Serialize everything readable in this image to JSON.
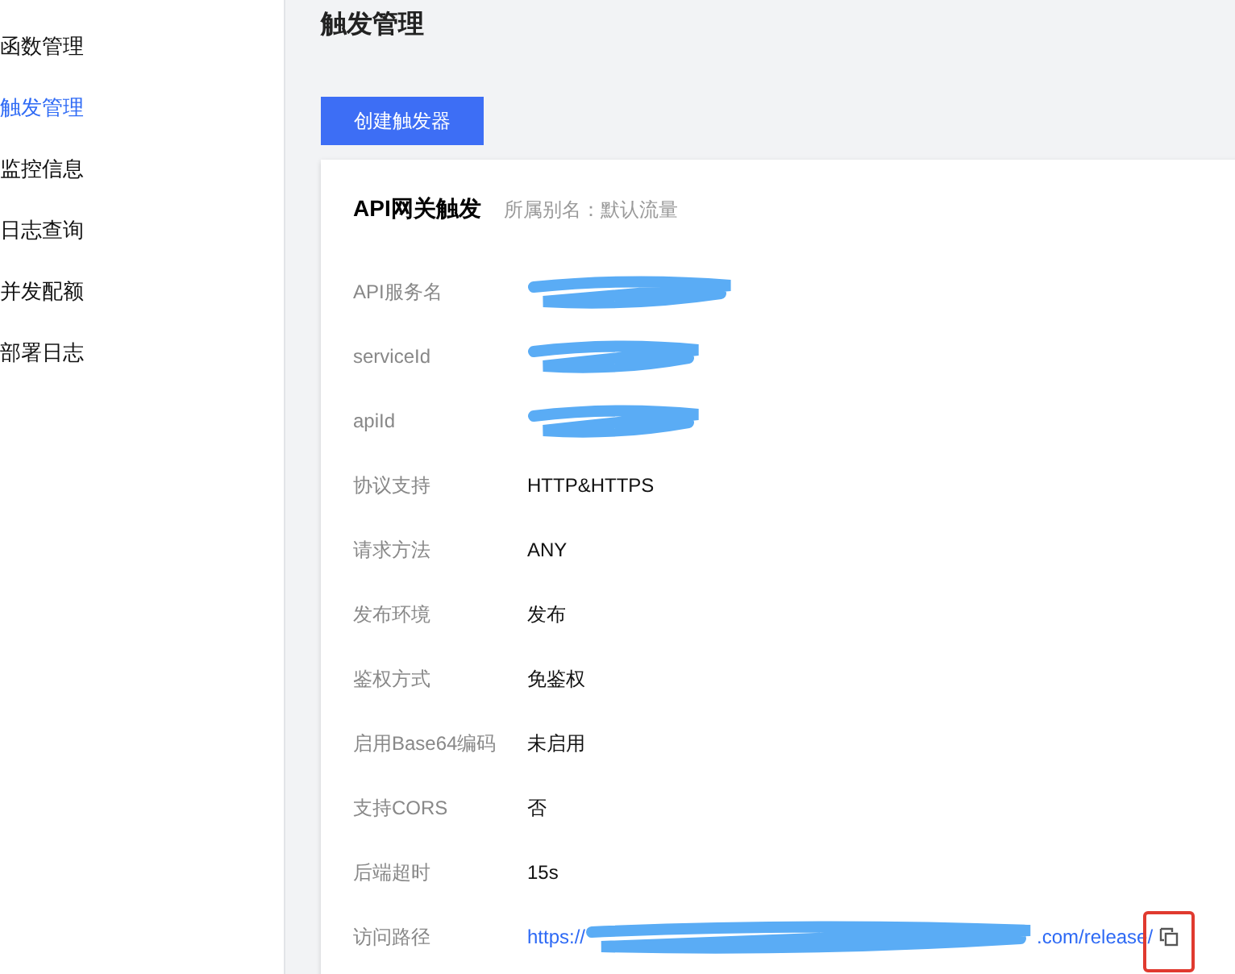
{
  "sidebar": {
    "items": [
      {
        "label": "函数管理",
        "selected": false
      },
      {
        "label": "触发管理",
        "selected": true
      },
      {
        "label": "监控信息",
        "selected": false
      },
      {
        "label": "日志查询",
        "selected": false
      },
      {
        "label": "并发配额",
        "selected": false
      },
      {
        "label": "部署日志",
        "selected": false
      }
    ]
  },
  "page_title": "触发管理",
  "create_button": "创建触发器",
  "trigger_card": {
    "title": "API网关触发",
    "alias": "所属别名：默认流量",
    "rows": [
      {
        "kind": "redacted",
        "label": "API服务名"
      },
      {
        "kind": "redacted",
        "label": "serviceId"
      },
      {
        "kind": "redacted",
        "label": "apiId"
      },
      {
        "kind": "text",
        "label": "协议支持",
        "value": "HTTP&HTTPS"
      },
      {
        "kind": "text",
        "label": "请求方法",
        "value": "ANY"
      },
      {
        "kind": "text",
        "label": "发布环境",
        "value": "发布"
      },
      {
        "kind": "text",
        "label": "鉴权方式",
        "value": "免鉴权"
      },
      {
        "kind": "text",
        "label": "启用Base64编码",
        "value": "未启用"
      },
      {
        "kind": "text",
        "label": "支持CORS",
        "value": "否"
      },
      {
        "kind": "text",
        "label": "后端超时",
        "value": "15s"
      },
      {
        "kind": "link",
        "label": "访问路径",
        "value_start": "https://",
        "value_end": ".com/release/",
        "copy_highlighted": true
      }
    ]
  }
}
